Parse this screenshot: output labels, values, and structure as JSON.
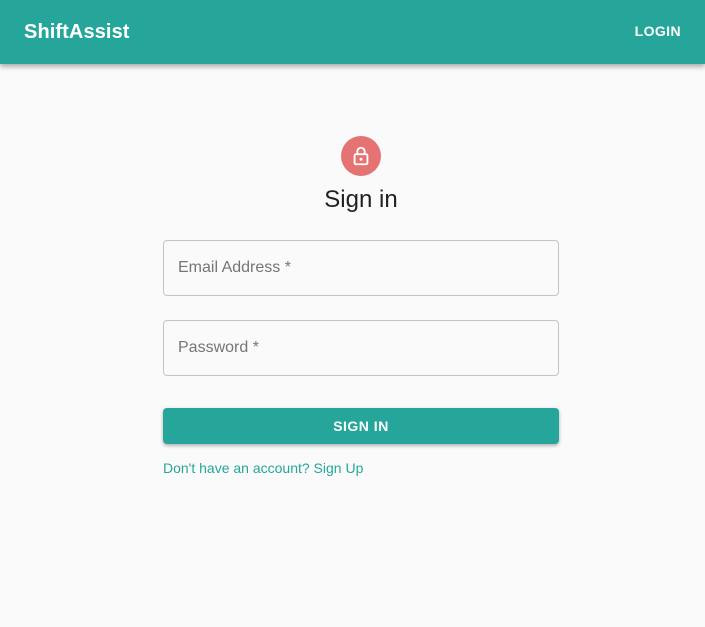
{
  "appbar": {
    "brand": "ShiftAssist",
    "login_label": "LOGIN"
  },
  "signin": {
    "icon": "lock-icon",
    "title": "Sign in",
    "email": {
      "label": "Email Address *",
      "value": ""
    },
    "password": {
      "label": "Password *",
      "value": ""
    },
    "submit_label": "SIGN IN",
    "signup_link": "Don't have an account? Sign Up"
  },
  "colors": {
    "primary": "#26a69a",
    "avatar": "#e57373",
    "background": "#fafafa"
  }
}
